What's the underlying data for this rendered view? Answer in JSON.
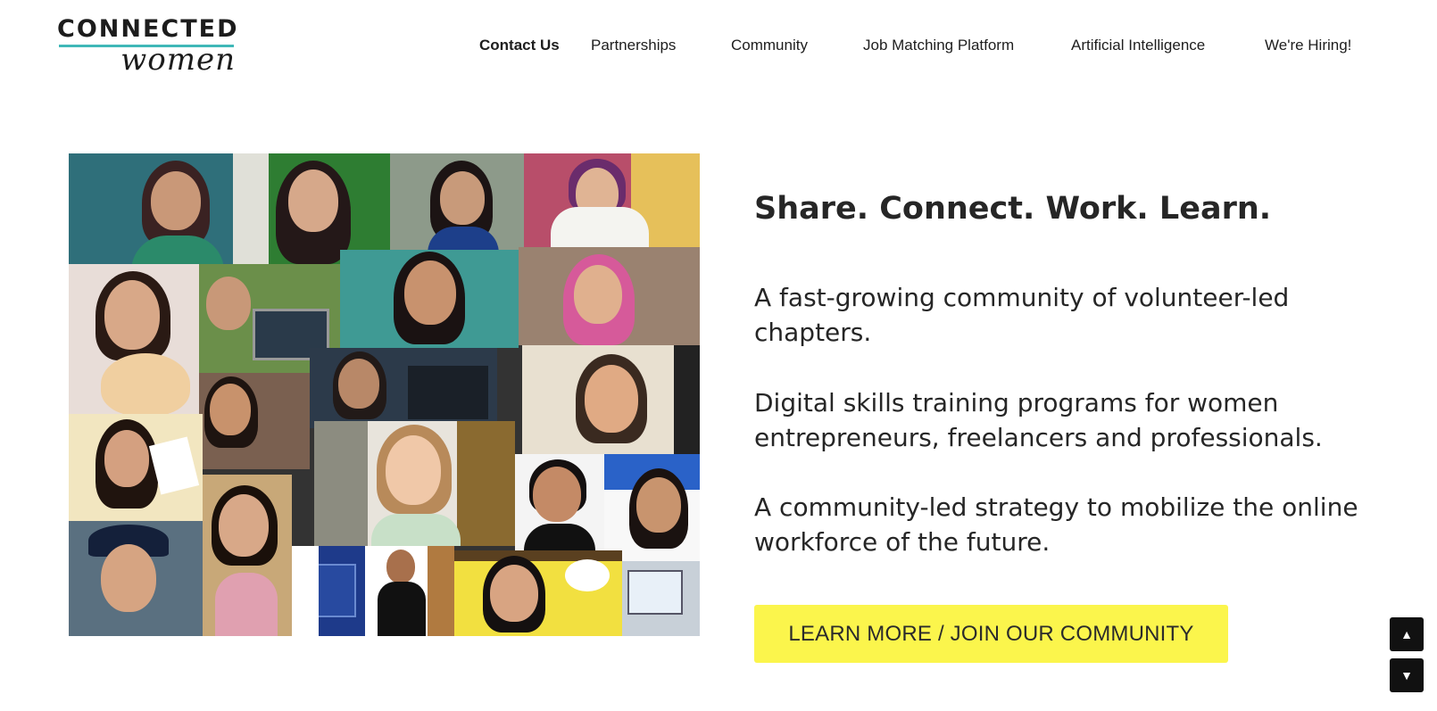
{
  "logo": {
    "line1": "CONNECTED",
    "line2": "women",
    "accent_color": "#3fb8b8"
  },
  "nav": {
    "items": [
      {
        "label": "Contact Us",
        "active": true
      },
      {
        "label": "Partnerships"
      },
      {
        "label": "Community"
      },
      {
        "label": "Job Matching Platform"
      },
      {
        "label": "Artificial Intelligence"
      },
      {
        "label": "We're Hiring!"
      }
    ]
  },
  "hero": {
    "image": {
      "icon": "video-call-collage-photo"
    },
    "headline": "Share. Connect. Work. Learn.",
    "paragraphs": [
      "A fast-growing community of volunteer-led chapters.",
      "Digital skills training programs for women entrepreneurs, freelancers and professionals.",
      "A community-led strategy to mobilize the online workforce of the future."
    ],
    "cta_label": "LEARN MORE / JOIN OUR COMMUNITY",
    "cta_color": "#fbf54c"
  },
  "scroll": {
    "up_icon": "triangle-up-icon",
    "down_icon": "triangle-down-icon",
    "up_glyph": "▲",
    "down_glyph": "▼"
  }
}
